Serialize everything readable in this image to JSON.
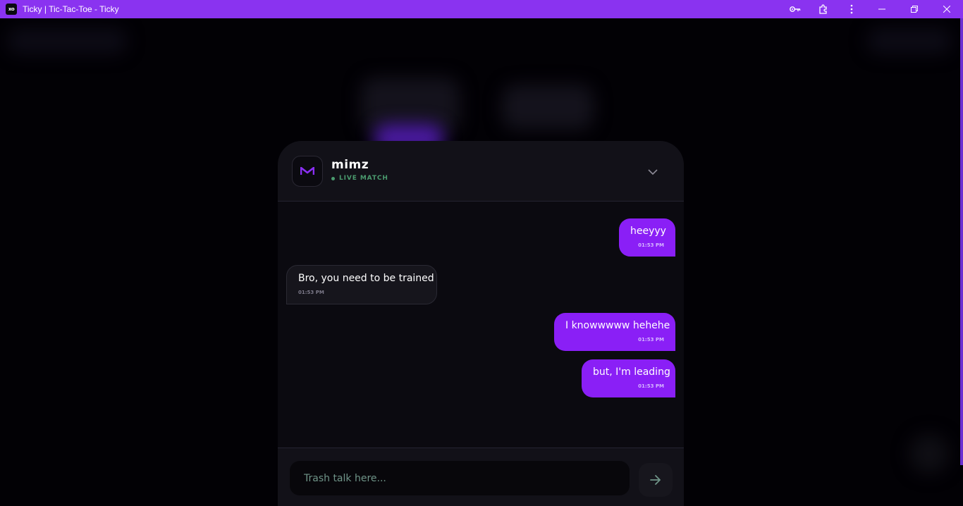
{
  "window": {
    "title": "Ticky | Tic-Tac-Toe - Ticky",
    "app_icon_text": "xo",
    "icons": [
      "key-icon",
      "extensions-icon",
      "more-icon",
      "minimize-icon",
      "restore-icon",
      "close-icon"
    ]
  },
  "chat": {
    "username": "mimz",
    "avatar_letter": "M",
    "status": "LIVE MATCH",
    "messages": [
      {
        "direction": "sent",
        "text": "heeyyy",
        "time": "01:53 PM"
      },
      {
        "direction": "received",
        "text": "Bro, you need to be trained",
        "time": "01:53 PM"
      },
      {
        "direction": "sent",
        "text": "I knowwwww hehehe",
        "time": "01:53 PM"
      },
      {
        "direction": "sent",
        "text": "but, I'm leading",
        "time": "01:53 PM"
      }
    ],
    "input_placeholder": "Trash talk here...",
    "input_value": ""
  },
  "colors": {
    "accent": "#8a33f0",
    "sent_bubble": "#8a1ff6",
    "panel_bg": "#0b0a10",
    "status_green": "#4a9a6e"
  }
}
